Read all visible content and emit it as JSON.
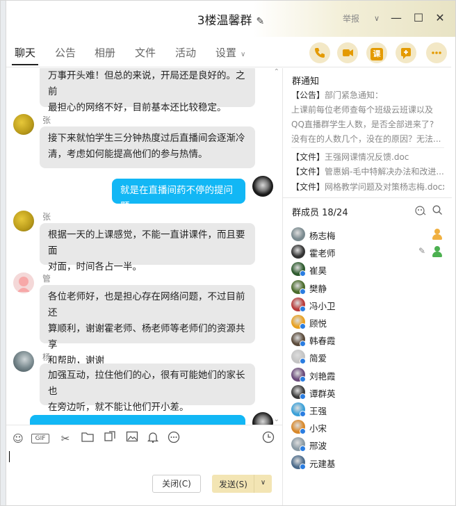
{
  "window": {
    "title": "3楼温馨群",
    "report_label": "举报"
  },
  "tabs": [
    {
      "label": "聊天"
    },
    {
      "label": "公告"
    },
    {
      "label": "相册"
    },
    {
      "label": "文件"
    },
    {
      "label": "活动"
    },
    {
      "label": "设置"
    }
  ],
  "actions": {
    "class_label": "课"
  },
  "messages": [
    {
      "sender": "",
      "mine": false,
      "text_lines": [
        "万事开头难！但总的来说，开局还是良好的。之前",
        "最担心的网络不好，目前基本还比较稳定。"
      ]
    },
    {
      "sender": "张磊津",
      "mine": false,
      "text_lines": [
        "接下来就怕学生三分钟热度过后直播间会逐渐冷",
        "清，考虑如何能提高他们的参与热情。"
      ]
    },
    {
      "sender": "",
      "mine": true,
      "text_lines": [
        "就是在直播间药不停的提问题"
      ]
    },
    {
      "sender": "张磊津",
      "mine": false,
      "text_lines": [
        "根据一天的上课感觉，不能一直讲课件，而且要面",
        "对面，时间各占一半。"
      ]
    },
    {
      "sender": "管",
      "mine": false,
      "text_lines": [
        "各位老师好，也是担心存在网络问题，不过目前还",
        "算顺利，谢谢霍老师、杨老师等老师们的资源共享",
        "和帮助，谢谢"
      ]
    },
    {
      "sender": "杨志梅",
      "mine": false,
      "text_lines": [
        "加强互动，拉住他们的心，很有可能她们的家长也",
        "在旁边听，就不能让他们开小差。"
      ]
    }
  ],
  "composer": {
    "close_label": "关闭(C)",
    "send_label": "发送(S)"
  },
  "notice": {
    "title": "群通知",
    "items": [
      {
        "tag": "【公告】",
        "text": "部门紧急通知："
      },
      {
        "tag": "",
        "text": "上课前每位老师查每个班级云班课以及"
      },
      {
        "tag": "",
        "text": "QQ直播群学生人数，是否全部进来了?"
      },
      {
        "tag": "",
        "text": "没有在的人数几个，没在的原因？无法..."
      },
      {
        "tag": "【文件】",
        "text": "王强网课情况反馈.doc"
      },
      {
        "tag": "【文件】",
        "text": "管惠娟-毛中特解决办法和改进..."
      },
      {
        "tag": "【文件】",
        "text": "网格教学问题及对策杨志梅.docx"
      }
    ]
  },
  "members": {
    "title": "群成员 18/24",
    "list": [
      {
        "name": "杨志梅",
        "role": "owner",
        "color": "#7a8a8f"
      },
      {
        "name": "霍老师",
        "role": "admin",
        "color": "#333333"
      },
      {
        "name": "崔昊",
        "role": "",
        "color": "#2d5a2d"
      },
      {
        "name": "樊静",
        "role": "",
        "color": "#4a6b2a"
      },
      {
        "name": "冯小卫",
        "role": "",
        "color": "#b83a3a"
      },
      {
        "name": "顾悦",
        "role": "",
        "color": "#e8a020"
      },
      {
        "name": "韩春霞",
        "role": "",
        "color": "#5a4a3a"
      },
      {
        "name": "简爱",
        "role": "",
        "color": "#c4c4c4"
      },
      {
        "name": "刘艳霞",
        "role": "",
        "color": "#6a4a7a"
      },
      {
        "name": "谭群英",
        "role": "",
        "color": "#3a3a3a"
      },
      {
        "name": "王强",
        "role": "",
        "color": "#3aa0d8"
      },
      {
        "name": "小宋",
        "role": "",
        "color": "#d8882a"
      },
      {
        "name": "邢波",
        "role": "",
        "color": "#8a9aa4"
      },
      {
        "name": "元建基",
        "role": "",
        "color": "#4a6a8a"
      }
    ]
  },
  "colors": {
    "accent": "#12b7f5",
    "send": "#f3e5b4",
    "icon_gold": "#e49a00"
  }
}
